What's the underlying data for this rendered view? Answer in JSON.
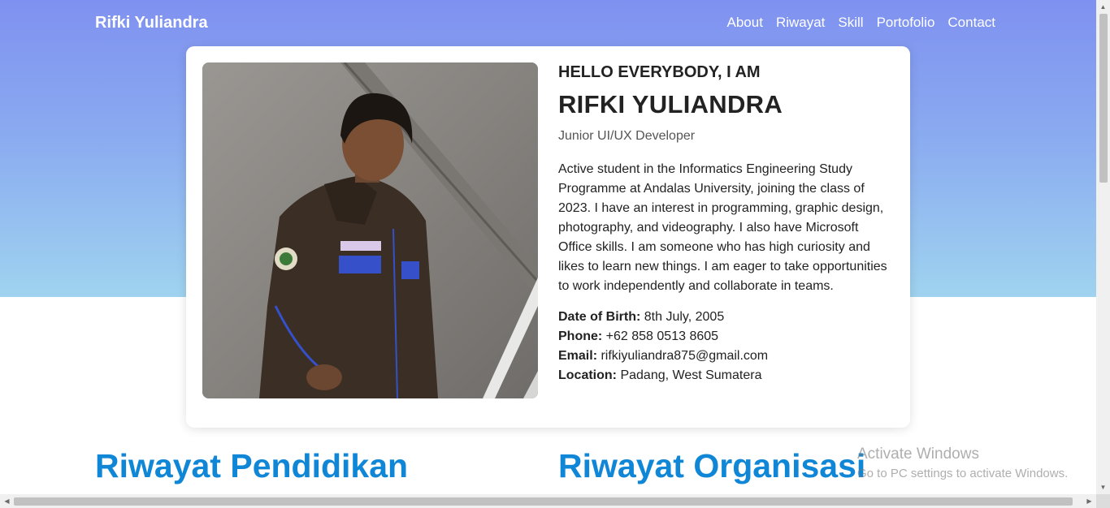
{
  "nav": {
    "brand": "Rifki Yuliandra",
    "links": [
      "About",
      "Riwayat",
      "Skill",
      "Portofolio",
      "Contact"
    ]
  },
  "profile": {
    "greeting": "HELLO EVERYBODY, I AM",
    "name": "RIFKI YULIANDRA",
    "role": "Junior UI/UX Developer",
    "about": "Active student in the Informatics Engineering Study Programme at Andalas University, joining the class of 2023. I have an interest in programming, graphic design, photography, and videography. I also have Microsoft Office skills. I am someone who has high curiosity and likes to learn new things. I am eager to take opportunities to work independently and collaborate in teams.",
    "details": [
      {
        "label": "Date of Birth:",
        "value": "8th July, 2005"
      },
      {
        "label": "Phone:",
        "value": "+62 858 0513 8605"
      },
      {
        "label": "Email:",
        "value": "rifkiyuliandra875@gmail.com"
      },
      {
        "label": "Location:",
        "value": "Padang, West Sumatera"
      }
    ],
    "photo_icon": "profile-photo"
  },
  "sections": {
    "education_title": "Riwayat Pendidikan",
    "organization_title": "Riwayat Organisasi"
  },
  "watermark": {
    "line1": "Activate Windows",
    "line2": "Go to PC settings to activate Windows."
  },
  "colors": {
    "hero_top": "#7f91f0",
    "hero_bottom": "#9fd3ef",
    "section_title": "#0f86d6"
  }
}
